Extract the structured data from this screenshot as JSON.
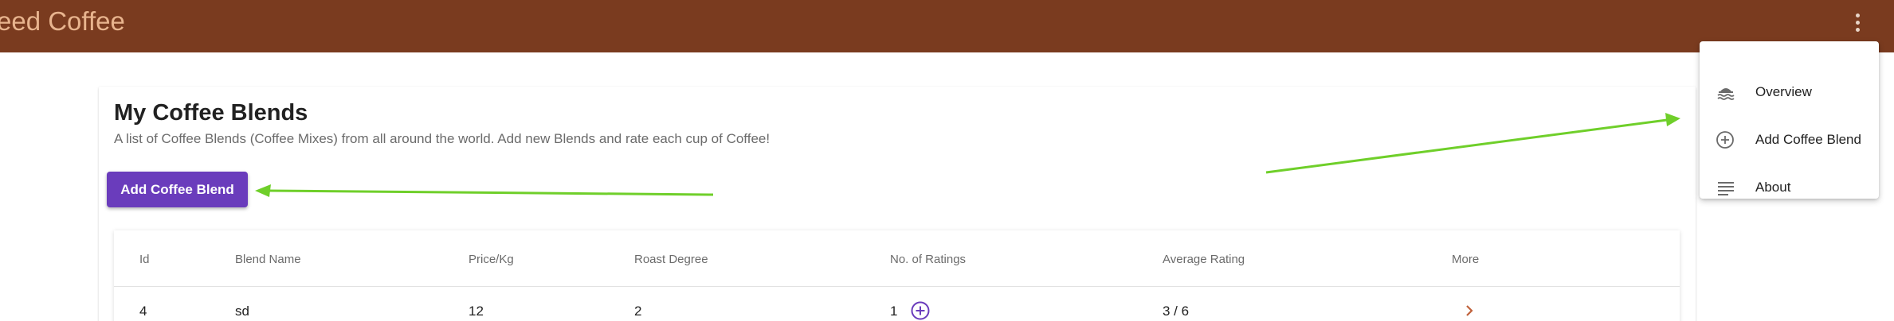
{
  "app": {
    "title": "eed Coffee"
  },
  "header": {
    "menu_icon": "more-vert-icon"
  },
  "page": {
    "title": "My Coffee Blends",
    "subtitle": "A list of Coffee Blends (Coffee Mixes) from all around the world. Add new Blends and rate each cup of Coffee!",
    "add_button_label": "Add Coffee Blend"
  },
  "table": {
    "columns": [
      "Id",
      "Blend Name",
      "Price/Kg",
      "Roast Degree",
      "No. of Ratings",
      "Average Rating",
      "More"
    ],
    "rows": [
      {
        "id": "4",
        "blend_name": "sd",
        "price": "12",
        "roast": "2",
        "ratings": "1",
        "average": "3 / 6"
      }
    ]
  },
  "menu": {
    "items": [
      {
        "label": "Overview",
        "icon": "overview-icon"
      },
      {
        "label": "Add Coffee Blend",
        "icon": "add-circle-icon"
      },
      {
        "label": "About",
        "icon": "notes-icon"
      }
    ]
  },
  "colors": {
    "appbar": "#7a3b1f",
    "title_text": "#e8b48e",
    "primary_button": "#6a3cbc",
    "annotation_arrow": "#6fcf2a"
  }
}
